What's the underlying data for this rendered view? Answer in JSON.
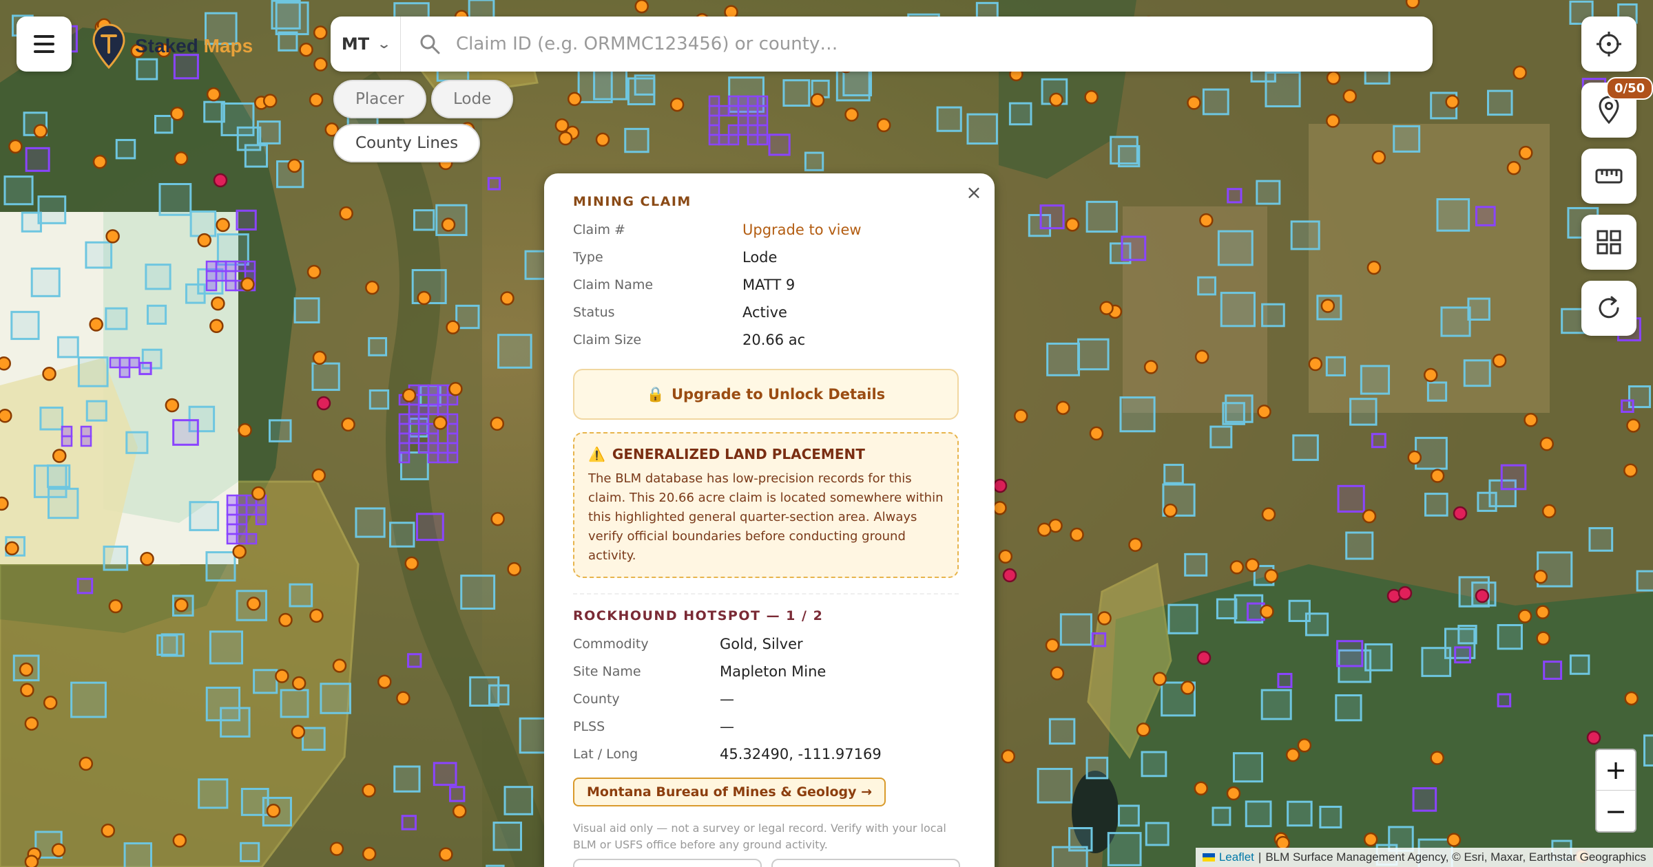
{
  "app": {
    "name_part1": "Staked",
    "name_part2": "Maps"
  },
  "colors": {
    "brand_dark": "#1f2a44",
    "brand_gold": "#e8a23a",
    "accent": "#b35d12",
    "hotspot": "#ff9a1f",
    "claim": "#8a44ff",
    "blm": "#6ec6e0"
  },
  "search": {
    "state": "MT",
    "placeholder": "Claim ID (e.g. ORMMC123456) or county…",
    "value": ""
  },
  "chips": {
    "placer": "Placer",
    "lode": "Lode",
    "county_lines": "County Lines"
  },
  "right_toolbar": {
    "pin_count": "0/50",
    "icons": [
      "locate-icon",
      "pin-icon",
      "ruler-icon",
      "grid-icon",
      "refresh-icon"
    ]
  },
  "zoom": {
    "in": "+",
    "out": "−"
  },
  "attribution": {
    "leaflet": "Leaflet",
    "sep": "|",
    "text": "BLM Surface Management Agency, © Esri, Maxar, Earthstar Geographics"
  },
  "popup": {
    "close": "×",
    "claim": {
      "title": "MINING CLAIM",
      "rows": [
        {
          "k": "Claim #",
          "v": "Upgrade to view"
        },
        {
          "k": "Type",
          "v": "Lode"
        },
        {
          "k": "Claim Name",
          "v": "MATT 9"
        },
        {
          "k": "Status",
          "v": "Active"
        },
        {
          "k": "Claim Size",
          "v": "20.66 ac"
        }
      ],
      "unlock_icon": "🔒",
      "unlock": "Upgrade to Unlock Details"
    },
    "warning": {
      "icon": "⚠️",
      "title": "GENERALIZED LAND PLACEMENT",
      "body": "The BLM database has low-precision records for this claim. This 20.66 acre claim is located somewhere within this highlighted general quarter-section area. Always verify official boundaries before conducting ground activity."
    },
    "hotspot": {
      "title": "ROCKHOUND HOTSPOT — 1 / 2",
      "rows": [
        {
          "k": "Commodity",
          "v": "Gold, Silver"
        },
        {
          "k": "Site Name",
          "v": "Mapleton Mine"
        },
        {
          "k": "County",
          "v": "—"
        },
        {
          "k": "PLSS",
          "v": "—"
        },
        {
          "k": "Lat / Long",
          "v": "45.32490, -111.97169"
        }
      ],
      "link": "Montana Bureau of Mines & Geology →"
    },
    "disclaimer": "Visual aid only — not a survey or legal record. Verify with your local BLM or USFS office before any ground activity."
  }
}
